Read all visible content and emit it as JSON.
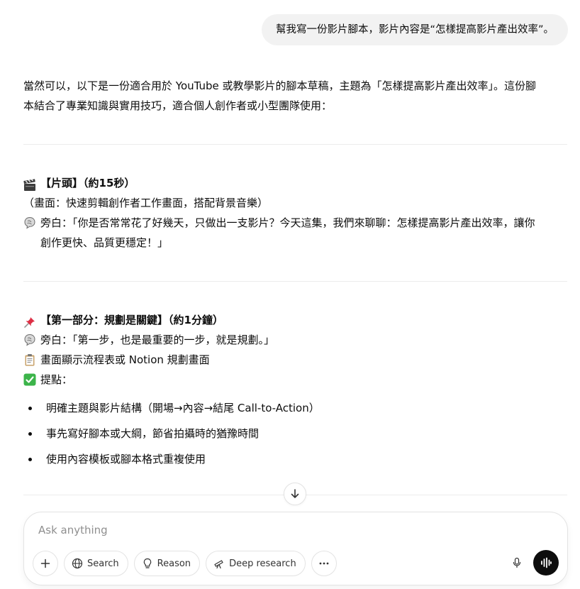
{
  "user_message": "幫我寫一份影片腳本，影片內容是“怎樣提高影片產出效率”。",
  "response": {
    "intro_line1": "當然可以，以下是一份適合用於 YouTube 或教學影片的腳本草稿，主題為「怎樣提高影片產出效率」。這份腳",
    "intro_line2": "本結合了專業知識與實用技巧，適合個人創作者或小型團隊使用：",
    "section1": {
      "title": "【片頭】（約15秒）",
      "scene": "（畫面：快速剪輯創作者工作畫面，搭配背景音樂）",
      "narration_line1": "旁白：「你是否常常花了好幾天，只做出一支影片？今天這集，我們來聊聊：怎樣提高影片產出效率，讓你",
      "narration_line2": "創作更快、品質更穩定！」"
    },
    "section2": {
      "title": "【第一部分：規劃是關鍵】（約1分鐘）",
      "narration": "旁白：「第一步，也是最重要的一步，就是規劃。」",
      "screen": "畫面顯示流程表或 Notion 規劃畫面",
      "tips_label": "提點：",
      "bullets": [
        "明確主題與影片結構（開場→內容→結尾 Call-to-Action）",
        "事先寫好腳本或大綱，節省拍攝時的猶豫時間",
        "使用內容模板或腳本格式重複使用"
      ]
    }
  },
  "composer": {
    "placeholder": "Ask anything",
    "search_label": "Search",
    "reason_label": "Reason",
    "deep_research_label": "Deep research"
  },
  "icons": {
    "clapper": "clapper-board-icon",
    "speech": "speech-bubble-icon",
    "pin": "pushpin-icon",
    "clipboard": "clipboard-icon",
    "check": "check-mark-icon"
  },
  "colors": {
    "bubble_bg": "#f2f2f2",
    "check_green": "#3cb44a",
    "pin_red": "#dd2e44"
  }
}
